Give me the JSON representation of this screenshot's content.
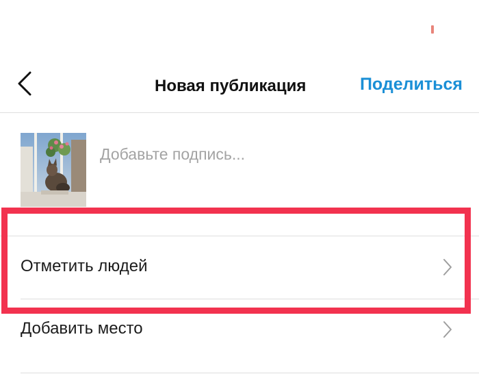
{
  "colors": {
    "accent": "#1a8fd6",
    "highlight": "#f2324f",
    "divider": "#dedede",
    "placeholder": "#a3a3a3"
  },
  "header": {
    "back_icon": "chevron-left-icon",
    "title": "Новая публикация",
    "share_label": "Поделиться"
  },
  "post": {
    "caption_placeholder": "Добавьте подпись...",
    "caption_value": ""
  },
  "options": [
    {
      "label": "Отметить людей",
      "icon": "chevron-right-icon",
      "highlighted": true
    },
    {
      "label": "Добавить место",
      "icon": "chevron-right-icon",
      "highlighted": false
    }
  ]
}
